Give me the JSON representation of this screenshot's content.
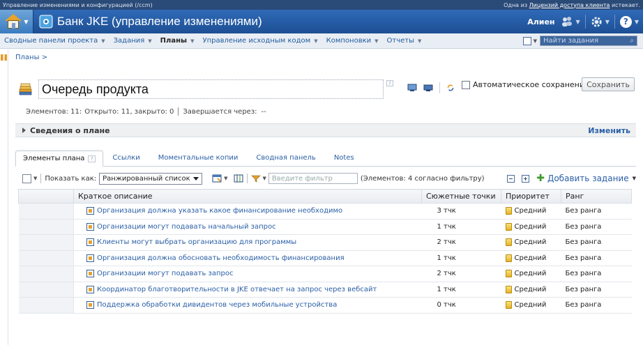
{
  "topstrip": {
    "left": "Управление изменениями и конфигурацией (/ccm)",
    "right_prefix": "Одна из",
    "right_link": "Лицензий доступа клиента",
    "right_suffix": "истекает."
  },
  "banner": {
    "project_title": "Банк JKE (управление изменениями)",
    "user_name": "Алиен"
  },
  "nav": {
    "items": [
      {
        "label": "Сводные панели проекта"
      },
      {
        "label": "Задания"
      },
      {
        "label": "Планы"
      },
      {
        "label": "Управление исходным кодом"
      },
      {
        "label": "Компоновки"
      },
      {
        "label": "Отчеты"
      }
    ],
    "search_placeholder": "Найти задания"
  },
  "breadcrumb": "Планы >",
  "plan": {
    "title": "Очередь продукта",
    "autosave_label": "Автоматическое сохранение",
    "save_label": "Сохранить",
    "help_mark": "?"
  },
  "stats": {
    "items_label": "Элементов: 11:",
    "open_closed": "Открыто: 11, закрыто: 0",
    "ends_label": "Завершается через:",
    "ends_value": "--"
  },
  "plan_info": {
    "label": "Сведения о плане",
    "edit": "Изменить"
  },
  "tabs": [
    {
      "label": "Элементы плана"
    },
    {
      "label": "Ссылки"
    },
    {
      "label": "Моментальные копии"
    },
    {
      "label": "Сводная панель"
    },
    {
      "label": "Notes"
    }
  ],
  "toolbar": {
    "show_as_label": "Показать как:",
    "view_mode": "Ранжированный список",
    "filter_placeholder": "Введите фильтр",
    "filter_count": "(Элементов: 4 согласно фильтру)",
    "add_work": "Добавить задание"
  },
  "table": {
    "headers": {
      "summary": "Краткое описание",
      "points": "Сюжетные точки",
      "priority": "Приоритет",
      "rank": "Ранг"
    },
    "rows": [
      {
        "summary": "Организация должна указать какое финансирование необходимо",
        "points": "3 тчк",
        "priority": "Средний",
        "rank": "Без ранга"
      },
      {
        "summary": "Организации могут подавать начальный запрос",
        "points": "1 тчк",
        "priority": "Средний",
        "rank": "Без ранга"
      },
      {
        "summary": "Клиенты могут выбрать организацию для программы",
        "points": "2 тчк",
        "priority": "Средний",
        "rank": "Без ранга"
      },
      {
        "summary": "Организация должна обосновать необходимость финансирования",
        "points": "1 тчк",
        "priority": "Средний",
        "rank": "Без ранга"
      },
      {
        "summary": "Организации могут подавать запрос",
        "points": "2 тчк",
        "priority": "Средний",
        "rank": "Без ранга"
      },
      {
        "summary": "Координатор благотворительности в JKE отвечает на запрос через вебсайт",
        "points": "1 тчк",
        "priority": "Средний",
        "rank": "Без ранга"
      },
      {
        "summary": "Поддержка обработки дивидентов через мобильные устройства",
        "points": "0 тчк",
        "priority": "Средний",
        "rank": "Без ранга"
      }
    ]
  }
}
